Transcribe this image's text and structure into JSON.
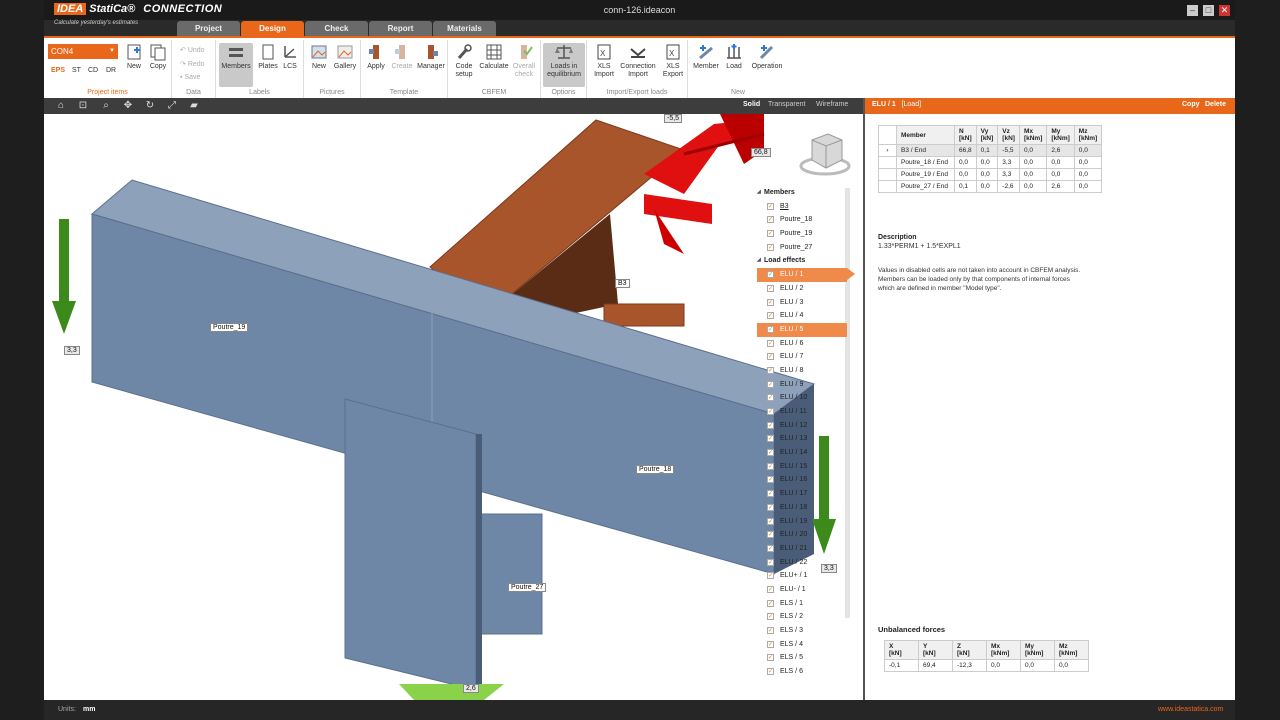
{
  "app": {
    "logo_idea": "IDEA",
    "logo_statica": "StatiCa®",
    "logo_product": "CONNECTION",
    "slogan": "Calculate yesterday's estimates",
    "window_title": "conn-126.ideacon"
  },
  "tabs": [
    {
      "label": "Project",
      "active": false
    },
    {
      "label": "Design",
      "active": true
    },
    {
      "label": "Check",
      "active": false
    },
    {
      "label": "Report",
      "active": false
    },
    {
      "label": "Materials",
      "active": false
    }
  ],
  "ribbon": {
    "project_items": {
      "title": "Project items",
      "dropdown_value": "CON4",
      "types": [
        "EPS",
        "ST",
        "CD",
        "DR"
      ],
      "new_label": "New",
      "copy_label": "Copy"
    },
    "data": {
      "title": "Data",
      "undo": "Undo",
      "redo": "Redo",
      "save": "Save"
    },
    "labels": {
      "title": "Labels",
      "members": "Members",
      "plates": "Plates",
      "lcs": "LCS"
    },
    "pictures": {
      "title": "Pictures",
      "new": "New",
      "gallery": "Gallery"
    },
    "template": {
      "title": "Template",
      "apply": "Apply",
      "create": "Create",
      "manager": "Manager"
    },
    "cbfem": {
      "title": "CBFEM",
      "code_setup_1": "Code",
      "code_setup_2": "setup",
      "calculate": "Calculate",
      "overall_1": "Overall",
      "overall_2": "check"
    },
    "options": {
      "title": "Options",
      "loads_1": "Loads in",
      "loads_2": "equilibrium"
    },
    "import_export": {
      "title": "Import/Export loads",
      "xls_import_1": "XLS",
      "xls_import_2": "Import",
      "conn_import_1": "Connection",
      "conn_import_2": "Import",
      "xls_export_1": "XLS",
      "xls_export_2": "Export"
    },
    "new_group": {
      "title": "New",
      "member": "Member",
      "load": "Load",
      "operation": "Operation"
    }
  },
  "viewbar": {
    "modes": [
      "Solid",
      "Transparent",
      "Wireframe"
    ],
    "active_mode": "Solid"
  },
  "viewport": {
    "labels": {
      "poutre_19": "Poutre_19",
      "poutre_18": "Poutre_18",
      "poutre_27": "Poutre_27",
      "b3": "B3",
      "force_left": "3,3",
      "force_top": "-5,5",
      "force_right": "3,3",
      "force_bottom": "2,6",
      "force_b3": "66,8"
    },
    "tree": {
      "members_header": "Members",
      "members": [
        "B3",
        "Poutre_18",
        "Poutre_19",
        "Poutre_27"
      ],
      "load_effects_header": "Load effects",
      "load_effects": [
        "ELU / 1",
        "ELU / 2",
        "ELU / 3",
        "ELU / 4",
        "ELU / 5",
        "ELU / 6",
        "ELU / 7",
        "ELU / 8",
        "ELU / 9",
        "ELU / 10",
        "ELU / 11",
        "ELU / 12",
        "ELU / 13",
        "ELU / 14",
        "ELU / 15",
        "ELU / 16",
        "ELU / 17",
        "ELU / 18",
        "ELU / 19",
        "ELU / 20",
        "ELU / 21",
        "ELU / 22",
        "ELU+ / 1",
        "ELU- / 1",
        "ELS / 1",
        "ELS / 2",
        "ELS / 3",
        "ELS / 4",
        "ELS / 5",
        "ELS / 6"
      ]
    }
  },
  "panel": {
    "header_title": "ELU / 1",
    "header_type": "[Load]",
    "copy": "Copy",
    "delete": "Delete",
    "table_headers": [
      "Member",
      "N\n[kN]",
      "Vy\n[kN]",
      "Vz\n[kN]",
      "Mx\n[kNm]",
      "My\n[kNm]",
      "Mz\n[kNm]"
    ],
    "rows": [
      [
        "B3 / End",
        "66,8",
        "0,1",
        "-5,5",
        "0,0",
        "2,6",
        "0,0"
      ],
      [
        "Poutre_18 / End",
        "0,0",
        "0,0",
        "3,3",
        "0,0",
        "0,0",
        "0,0"
      ],
      [
        "Poutre_19 / End",
        "0,0",
        "0,0",
        "3,3",
        "0,0",
        "0,0",
        "0,0"
      ],
      [
        "Poutre_27 / End",
        "0,1",
        "0,0",
        "-2,6",
        "0,0",
        "2,6",
        "0,0"
      ]
    ],
    "description_title": "Description",
    "description": "1.33*PERM1 + 1.5*EXPL1",
    "note": "Values in disabled cells are not taken into account in CBFEM analysis. Members can be loaded only by that components of internal forces which are defined in member \"Model type\".",
    "unbalanced_title": "Unbalanced forces",
    "unbalanced_headers": [
      "X\n[kN]",
      "Y\n[kN]",
      "Z\n[kN]",
      "Mx\n[kNm]",
      "My\n[kNm]",
      "Mz\n[kNm]"
    ],
    "unbalanced_values": [
      "-0,1",
      "69,4",
      "-12,3",
      "0,0",
      "0,0",
      "0,0"
    ]
  },
  "status": {
    "units_label": "Units:",
    "units_value": "mm",
    "website": "www.ideastatica.com"
  },
  "colors": {
    "accent": "#e8671a",
    "steel": "#6f87a6",
    "column": "#a9552b",
    "force_green": "#3d8a1c",
    "force_red": "#e01010"
  }
}
